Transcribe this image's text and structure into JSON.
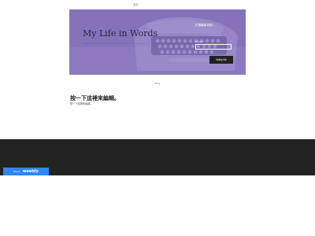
{
  "nav": {
    "items": [
      {
        "label": "首頁",
        "active": true
      },
      {
        "label": "　　　　　　　　",
        "active": false
      },
      {
        "label": "　　　",
        "active": false
      }
    ]
  },
  "hero": {
    "title": "My Life in Words",
    "subtitle": "......................................................................................",
    "form_heading": "訂閱最新消息!",
    "email_label": "Email *",
    "email_value": "",
    "email_placeholder": "",
    "notify_button": "Notify Me"
  },
  "section_label": "Blog",
  "content": {
    "title": "按一下這裡來編輯。",
    "body": "按一下這裡來編輯。"
  },
  "footer": {
    "badge_small": "BLOG",
    "badge_brand": "weebly"
  },
  "colors": {
    "hero_tint": "#8269be",
    "footer_bg": "#222222",
    "badge_bg": "#2f86f6",
    "button_bg": "#222226"
  }
}
